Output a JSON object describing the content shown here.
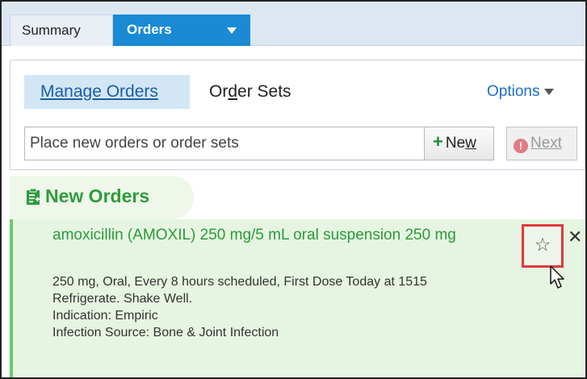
{
  "tabs": [
    {
      "label": "Summary",
      "active": false
    },
    {
      "label": "Orders",
      "active": true
    }
  ],
  "manage": {
    "manage_orders_label": "Manage Orders",
    "order_sets_label_pre": "Or",
    "order_sets_label_u": "d",
    "order_sets_label_post": "er Sets",
    "options_label": "Options"
  },
  "search": {
    "placeholder": "Place new orders or order sets",
    "value": ""
  },
  "buttons": {
    "new_label_pre": "Ne",
    "new_label_u": "w",
    "next_label": "Next"
  },
  "new_orders": {
    "title": "New Orders",
    "order": {
      "name": "amoxicillin (AMOXIL) 250 mg/5 mL oral suspension 250 mg",
      "details": [
        "250 mg, Oral, Every 8 hours scheduled, First Dose Today at 1515",
        "Refrigerate. Shake Well.",
        "Indication: Empiric",
        "Infection Source: Bone & Joint Infection"
      ]
    }
  },
  "icons": {
    "accent": "#1a8ad4",
    "green": "#2e9c3c",
    "highlight": "#e23a3a"
  }
}
